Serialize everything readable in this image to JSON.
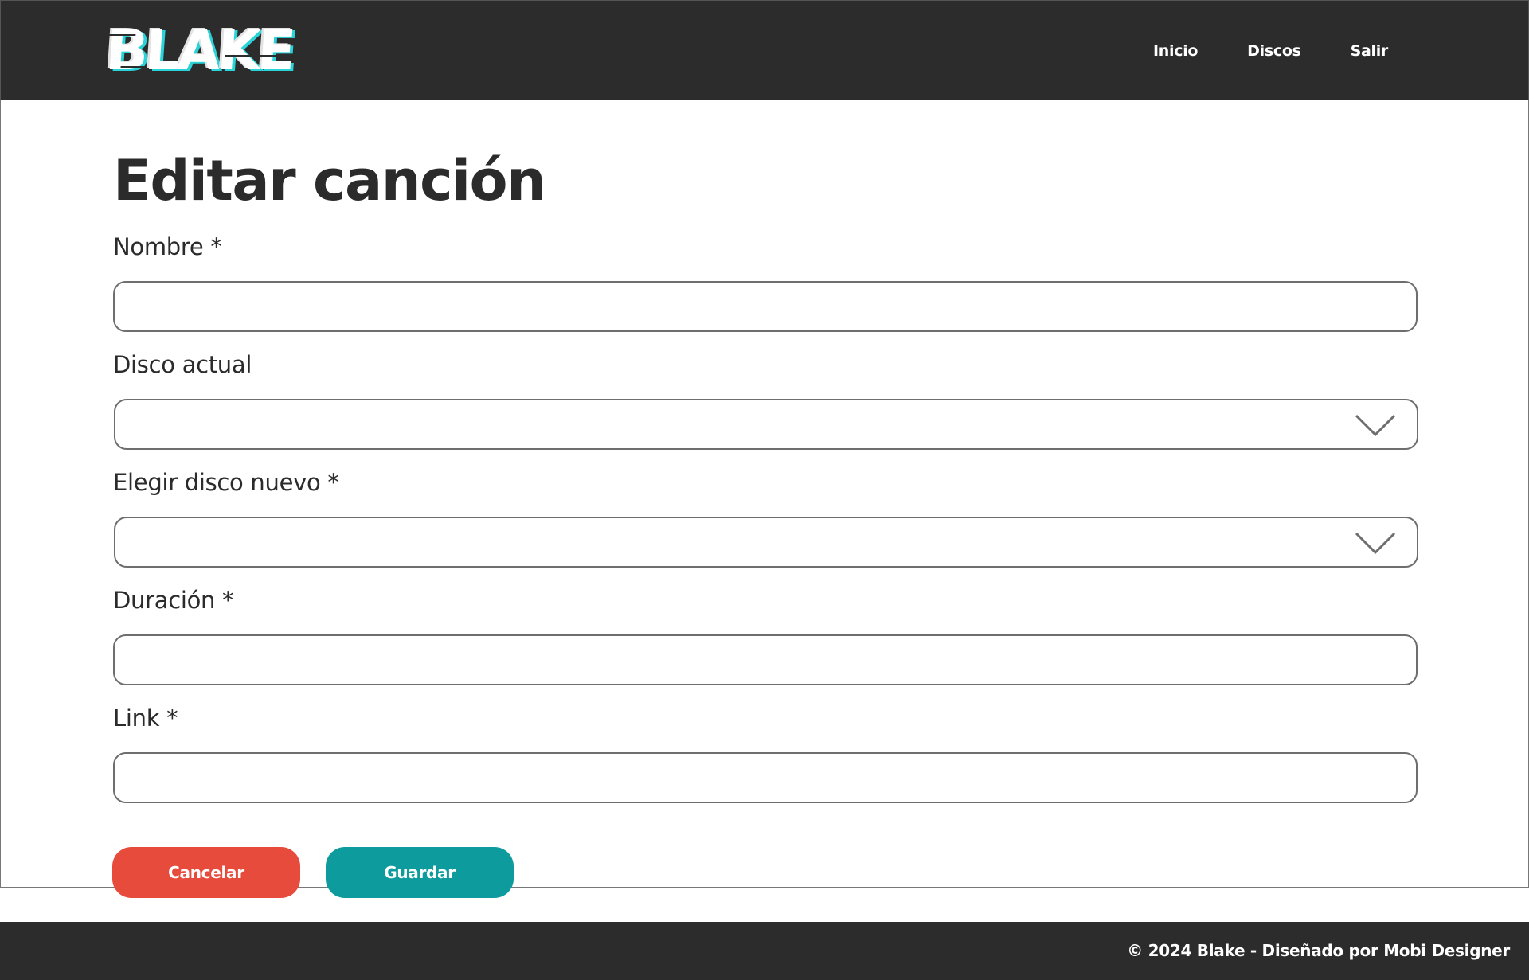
{
  "header": {
    "logo_text": "BLAKE",
    "nav": [
      {
        "label": "Inicio"
      },
      {
        "label": "Discos"
      },
      {
        "label": "Salir"
      }
    ]
  },
  "main": {
    "title": "Editar canción",
    "fields": {
      "nombre": {
        "label": "Nombre *",
        "value": ""
      },
      "disco_actual": {
        "label": "Disco actual",
        "value": ""
      },
      "disco_nuevo": {
        "label": "Elegir disco nuevo *",
        "value": ""
      },
      "duracion": {
        "label": "Duración *",
        "value": ""
      },
      "link": {
        "label": "Link *",
        "value": ""
      }
    },
    "buttons": {
      "cancel_label": "Cancelar",
      "save_label": "Guardar"
    }
  },
  "footer": {
    "text": "© 2024 Blake - Diseñado por Mobi Designer"
  },
  "colors": {
    "header_bg": "#2c2c2c",
    "cancel": "#e64b3c",
    "save": "#0e9b9e",
    "logo_glitch": "#29d3d8"
  },
  "icons": {
    "select_chevron": "chevron-down-icon"
  }
}
